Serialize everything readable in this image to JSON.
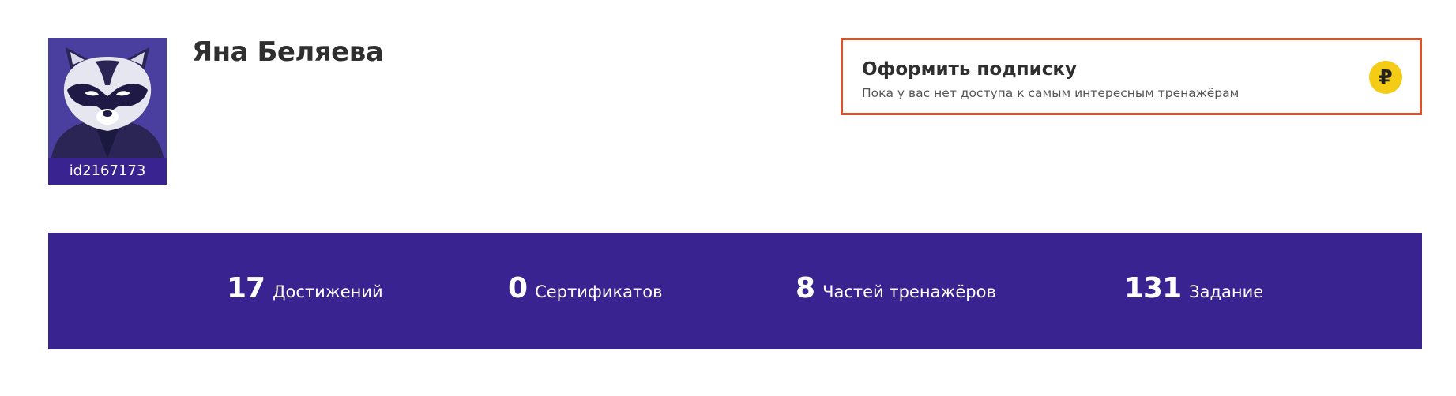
{
  "profile": {
    "name": "Яна Беляева",
    "user_id": "id2167173",
    "avatar_icon": "raccoon-avatar"
  },
  "subscription": {
    "title": "Оформить подписку",
    "subtitle": "Пока у вас нет доступа к самым интересным тренажёрам",
    "icon": "ruble-icon",
    "icon_glyph": "₽",
    "border_color": "#d9532c",
    "icon_color": "#f5cc15"
  },
  "stats": {
    "background": "#392390",
    "items": [
      {
        "value": "17",
        "label": "Достижений"
      },
      {
        "value": "0",
        "label": "Сертификатов"
      },
      {
        "value": "8",
        "label": "Частей тренажёров"
      },
      {
        "value": "131",
        "label": "Задание"
      }
    ]
  }
}
